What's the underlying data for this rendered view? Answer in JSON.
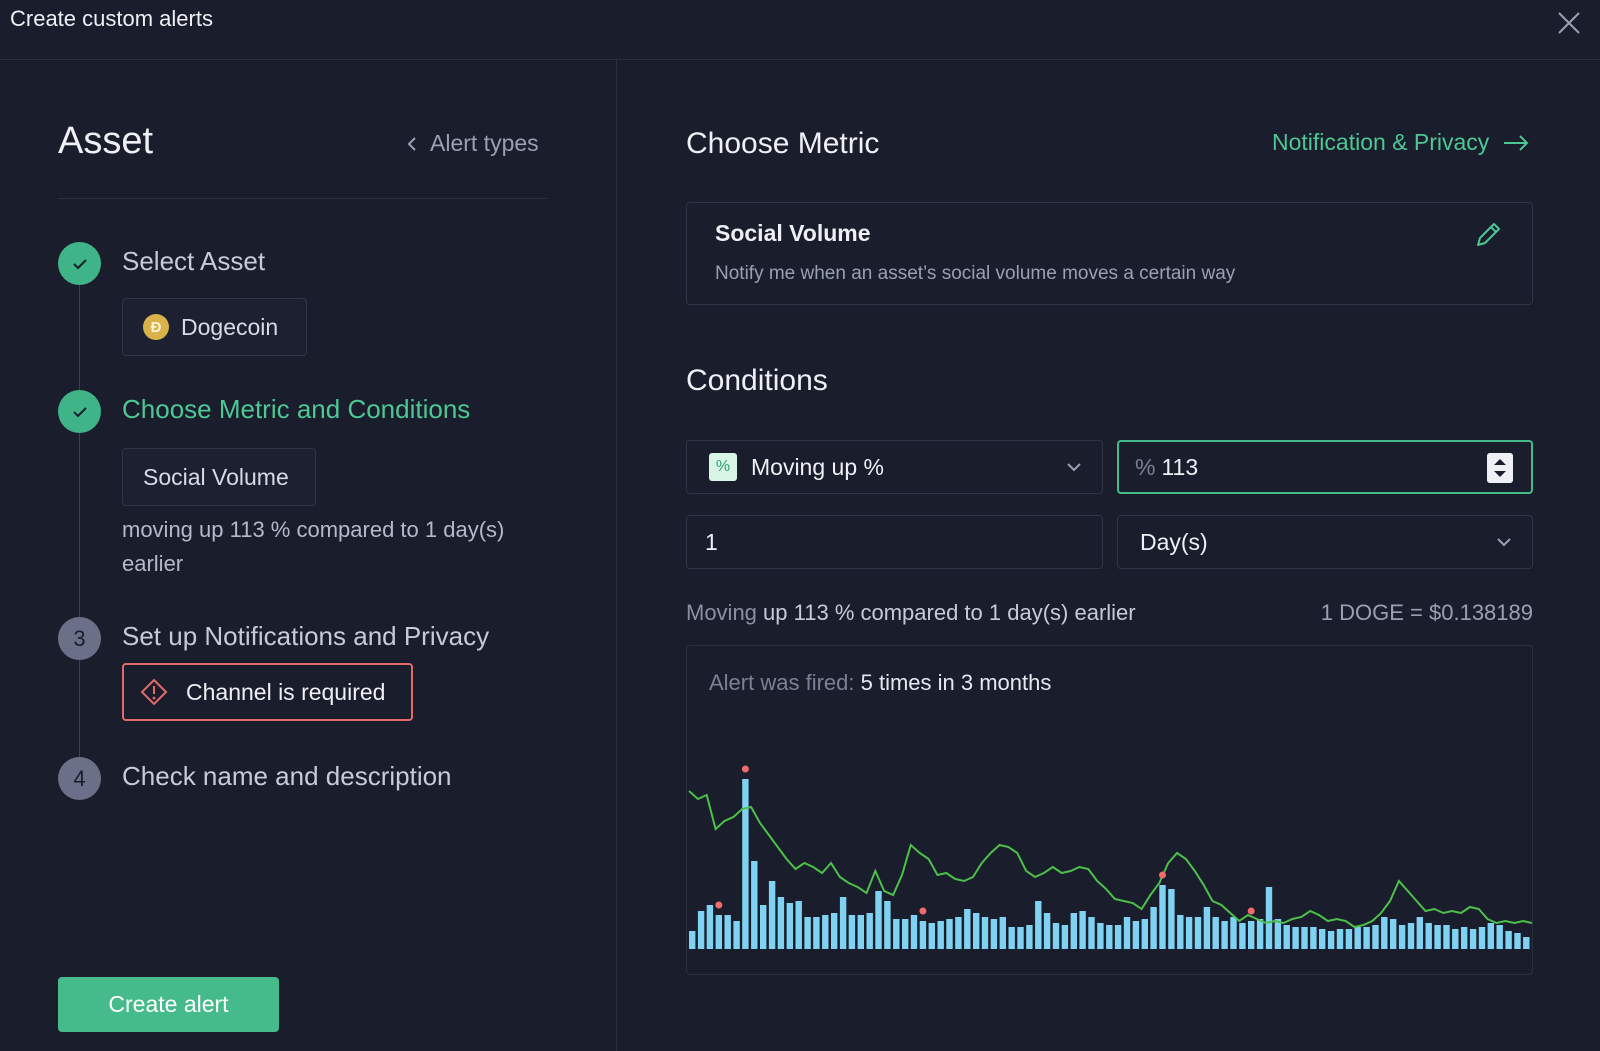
{
  "header": {
    "title": "Create custom alerts"
  },
  "left": {
    "title": "Asset",
    "back_link": "Alert types",
    "steps": [
      {
        "label": "Select Asset",
        "status": "done"
      },
      {
        "label": "Choose Metric and Conditions",
        "status": "done"
      },
      {
        "number": "3",
        "label": "Set up Notifications and Privacy",
        "status": "todo"
      },
      {
        "number": "4",
        "label": "Check name and description",
        "status": "todo"
      }
    ],
    "asset_chip": "Dogecoin",
    "metric_chip": "Social Volume",
    "condition_desc": "moving up 113 % compared to 1 day(s) earlier",
    "error": "Channel is required",
    "create_button": "Create alert"
  },
  "right": {
    "title": "Choose Metric",
    "next_link": "Notification & Privacy",
    "metric": {
      "name": "Social Volume",
      "description": "Notify me when an asset’s social volume moves a certain way"
    },
    "conditions_title": "Conditions",
    "operation": "Moving up %",
    "percent_prefix": "%",
    "percent_value": "113",
    "time_value": "1",
    "time_unit": "Day(s)",
    "summary_muted": "Moving",
    "summary_main": "up 113 % compared to 1 day(s) earlier",
    "price": "1 DOGE = $0.138189",
    "fired_label": "Alert was fired:",
    "fired_value": "5 times in 3 months"
  },
  "colors": {
    "accent": "#45bb8b",
    "error": "#e06b6b",
    "bar": "#7fd2f2",
    "line": "#4cc04a",
    "signal": "#f06b6b"
  },
  "chart_data": {
    "type": "bar",
    "bar_series": [
      18,
      38,
      44,
      34,
      34,
      28,
      170,
      88,
      44,
      68,
      52,
      46,
      48,
      32,
      32,
      34,
      36,
      52,
      34,
      34,
      36,
      58,
      48,
      30,
      30,
      34,
      28,
      26,
      28,
      30,
      32,
      40,
      36,
      32,
      30,
      32,
      22,
      22,
      24,
      48,
      36,
      26,
      24,
      36,
      38,
      32,
      26,
      24,
      24,
      32,
      28,
      30,
      42,
      64,
      60,
      34,
      32,
      32,
      42,
      32,
      28,
      32,
      26,
      28,
      30,
      62,
      30,
      24,
      22,
      22,
      22,
      20,
      18,
      20,
      20,
      22,
      22,
      24,
      32,
      30,
      24,
      26,
      32,
      26,
      24,
      24,
      20,
      22,
      20,
      22,
      26,
      24,
      18,
      16,
      12
    ],
    "line_series": [
      158,
      150,
      154,
      120,
      128,
      132,
      140,
      142,
      126,
      114,
      102,
      90,
      80,
      86,
      82,
      76,
      86,
      72,
      66,
      62,
      56,
      78,
      58,
      54,
      74,
      104,
      96,
      90,
      74,
      76,
      70,
      68,
      72,
      86,
      96,
      104,
      102,
      96,
      78,
      72,
      76,
      82,
      76,
      78,
      82,
      80,
      68,
      60,
      50,
      48,
      46,
      40,
      54,
      66,
      86,
      96,
      90,
      78,
      64,
      48,
      44,
      36,
      28,
      34,
      30,
      26,
      28,
      26,
      30,
      32,
      38,
      34,
      28,
      30,
      28,
      22,
      24,
      28,
      36,
      48,
      68,
      58,
      48,
      38,
      40,
      36,
      38,
      36,
      42,
      40,
      30,
      26,
      28,
      26,
      28,
      26
    ],
    "signal_indices": [
      3,
      6,
      26,
      53,
      63
    ]
  }
}
